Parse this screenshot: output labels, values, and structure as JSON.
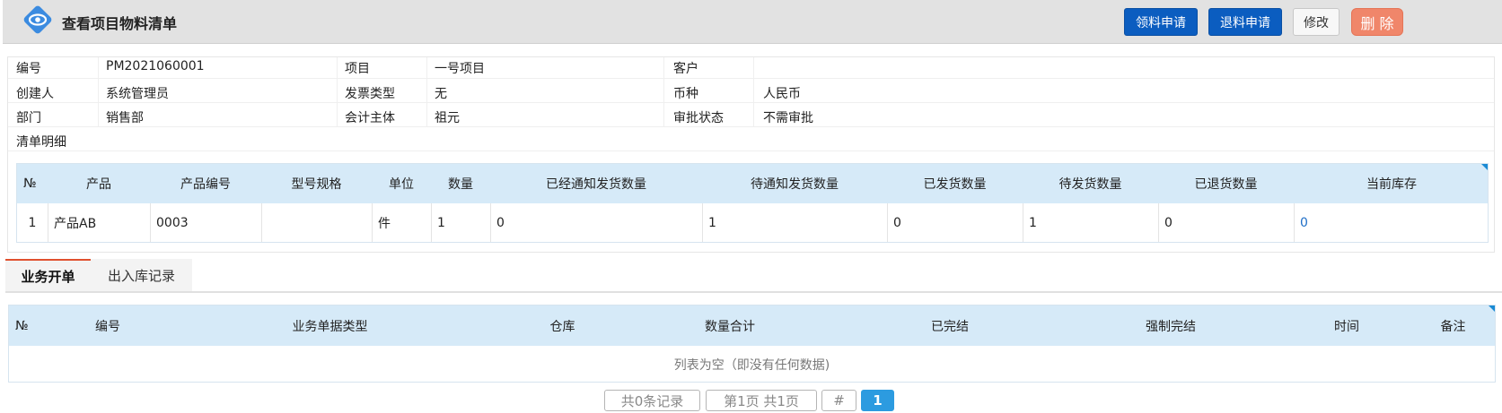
{
  "header": {
    "title": "查看项目物料清单",
    "buttons": {
      "material_request": "领料申请",
      "material_return": "退料申请",
      "edit": "修改",
      "delete": "删 除"
    }
  },
  "info": {
    "labels": {
      "code": "编号",
      "project": "项目",
      "customer": "客户",
      "creator": "创建人",
      "invoice_type": "发票类型",
      "currency": "币种",
      "department": "部门",
      "accounting_entity": "会计主体",
      "approval_status": "审批状态",
      "detail": "清单明细"
    },
    "values": {
      "code": "PM2021060001",
      "project": "一号项目",
      "customer": "",
      "creator": "系统管理员",
      "invoice_type": "无",
      "currency": "人民币",
      "department": "销售部",
      "accounting_entity": "祖元",
      "approval_status": "不需审批"
    }
  },
  "detail_table": {
    "headers": [
      "№",
      "产品",
      "产品编号",
      "型号规格",
      "单位",
      "数量",
      "已经通知发货数量",
      "待通知发货数量",
      "已发货数量",
      "待发货数量",
      "已退货数量",
      "当前库存"
    ],
    "rows": [
      [
        "1",
        "产品AB",
        "0003",
        "",
        "件",
        "1",
        "0",
        "1",
        "0",
        "1",
        "0",
        "0"
      ]
    ]
  },
  "tabs": {
    "business_orders": "业务开单",
    "stock_records": "出入库记录"
  },
  "orders_table": {
    "headers": [
      "№",
      "编号",
      "业务单据类型",
      "仓库",
      "数量合计",
      "已完结",
      "强制完结",
      "时间",
      "备注"
    ],
    "empty_text": "列表为空（即没有任何数据)"
  },
  "pager": {
    "total": "共0条记录",
    "page_info": "第1页 共1页",
    "hash": "#",
    "current_page": "1"
  },
  "colors": {
    "primary": "#0b5dc0",
    "danger": "#f0866a",
    "table_header": "#d6eaf8",
    "link": "#1f6fc7",
    "active_tab": "#e0502e"
  }
}
